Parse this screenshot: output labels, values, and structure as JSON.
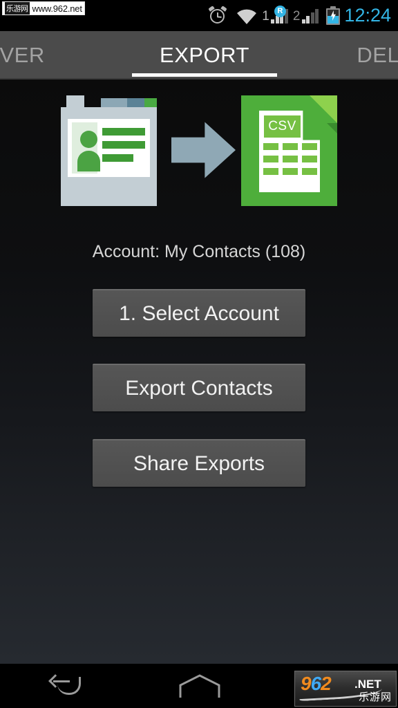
{
  "status_bar": {
    "alarm_icon": "alarm-clock-icon",
    "wifi_icon": "wifi-icon",
    "sim1_label": "1",
    "sim1_roaming_badge": "R",
    "sim2_label": "2",
    "battery_icon": "battery-charging-icon",
    "time": "12:24",
    "accent_color": "#33b5e5"
  },
  "tabs": [
    {
      "label": "COVER",
      "active": false,
      "name": "tab-recover"
    },
    {
      "label": "EXPORT",
      "active": true,
      "name": "tab-export"
    },
    {
      "label": "DELETE",
      "active": false,
      "name": "tab-delete"
    }
  ],
  "hero": {
    "source_icon": "contact-card-icon",
    "arrow_icon": "right-arrow-icon",
    "target_icon": "csv-file-icon",
    "csv_label": "CSV",
    "colors": {
      "card_body": "#c3ced4",
      "card_green": "#3f9b35",
      "arrow": "#8fa8b5",
      "arrow_shadow": "#31596b",
      "csv_green": "#4eae3b",
      "csv_light_green": "#76c043"
    }
  },
  "main": {
    "account_text": "Account: My Contacts (108)",
    "buttons": [
      {
        "label": "1. Select Account",
        "name": "select-account-button"
      },
      {
        "label": "Export Contacts",
        "name": "export-contacts-button"
      },
      {
        "label": "Share Exports",
        "name": "share-exports-button"
      }
    ]
  },
  "nav_bar": {
    "back_icon": "back-icon",
    "home_icon": "home-icon",
    "recents_icon": "recents-icon"
  },
  "watermarks": {
    "top": {
      "cn": "乐游网",
      "url": "www.962.net"
    },
    "bottom": {
      "digits_962": "962",
      "net": ".NET",
      "cn": "乐游网"
    }
  }
}
